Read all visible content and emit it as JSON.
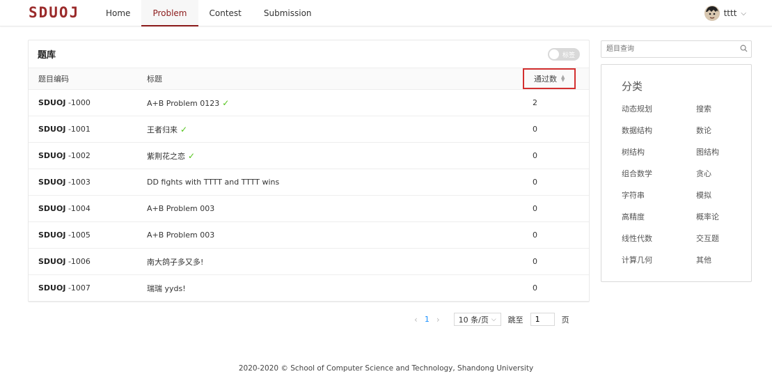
{
  "header": {
    "logo": "SDUOJ",
    "nav": [
      "Home",
      "Problem",
      "Contest",
      "Submission"
    ],
    "active_nav": "Problem",
    "user": "tttt"
  },
  "problems": {
    "title": "题库",
    "toggle_label": "标签",
    "columns": [
      "题目编码",
      "标题",
      "通过数"
    ],
    "rows": [
      {
        "prefix": "SDUOJ",
        "code": "-1000",
        "title": "A+B Problem 0123",
        "solved": true,
        "accepted": "2"
      },
      {
        "prefix": "SDUOJ",
        "code": "-1001",
        "title": "王者归来",
        "solved": true,
        "accepted": "0"
      },
      {
        "prefix": "SDUOJ",
        "code": "-1002",
        "title": "紫荆花之恋",
        "solved": true,
        "accepted": "0"
      },
      {
        "prefix": "SDUOJ",
        "code": "-1003",
        "title": "DD fights with TTTT and TTTT wins",
        "solved": false,
        "accepted": "0"
      },
      {
        "prefix": "SDUOJ",
        "code": "-1004",
        "title": "A+B Problem 003",
        "solved": false,
        "accepted": "0"
      },
      {
        "prefix": "SDUOJ",
        "code": "-1005",
        "title": "A+B Problem 003",
        "solved": false,
        "accepted": "0"
      },
      {
        "prefix": "SDUOJ",
        "code": "-1006",
        "title": "南大鸽子多又多!",
        "solved": false,
        "accepted": "0"
      },
      {
        "prefix": "SDUOJ",
        "code": "-1007",
        "title": "瑞瑞 yyds!",
        "solved": false,
        "accepted": "0"
      }
    ]
  },
  "pagination": {
    "prev": "‹",
    "current": "1",
    "next": "›",
    "page_size": "10 条/页",
    "jump_label": "跳至",
    "jump_value": "1",
    "page_suffix": "页"
  },
  "search": {
    "placeholder": "题目查询"
  },
  "categories": {
    "title": "分类",
    "items": [
      "动态规划",
      "搜索",
      "数据结构",
      "数论",
      "树结构",
      "图结构",
      "组合数学",
      "贪心",
      "字符串",
      "模拟",
      "高精度",
      "概率论",
      "线性代数",
      "交互题",
      "计算几何",
      "其他"
    ]
  },
  "footer": "2020-2020 © School of Computer Science and Technology, Shandong University",
  "colors": {
    "brand": "#8b1a1a",
    "link": "#1890ff",
    "check": "#52c41a",
    "highlight": "#d32f2f"
  }
}
